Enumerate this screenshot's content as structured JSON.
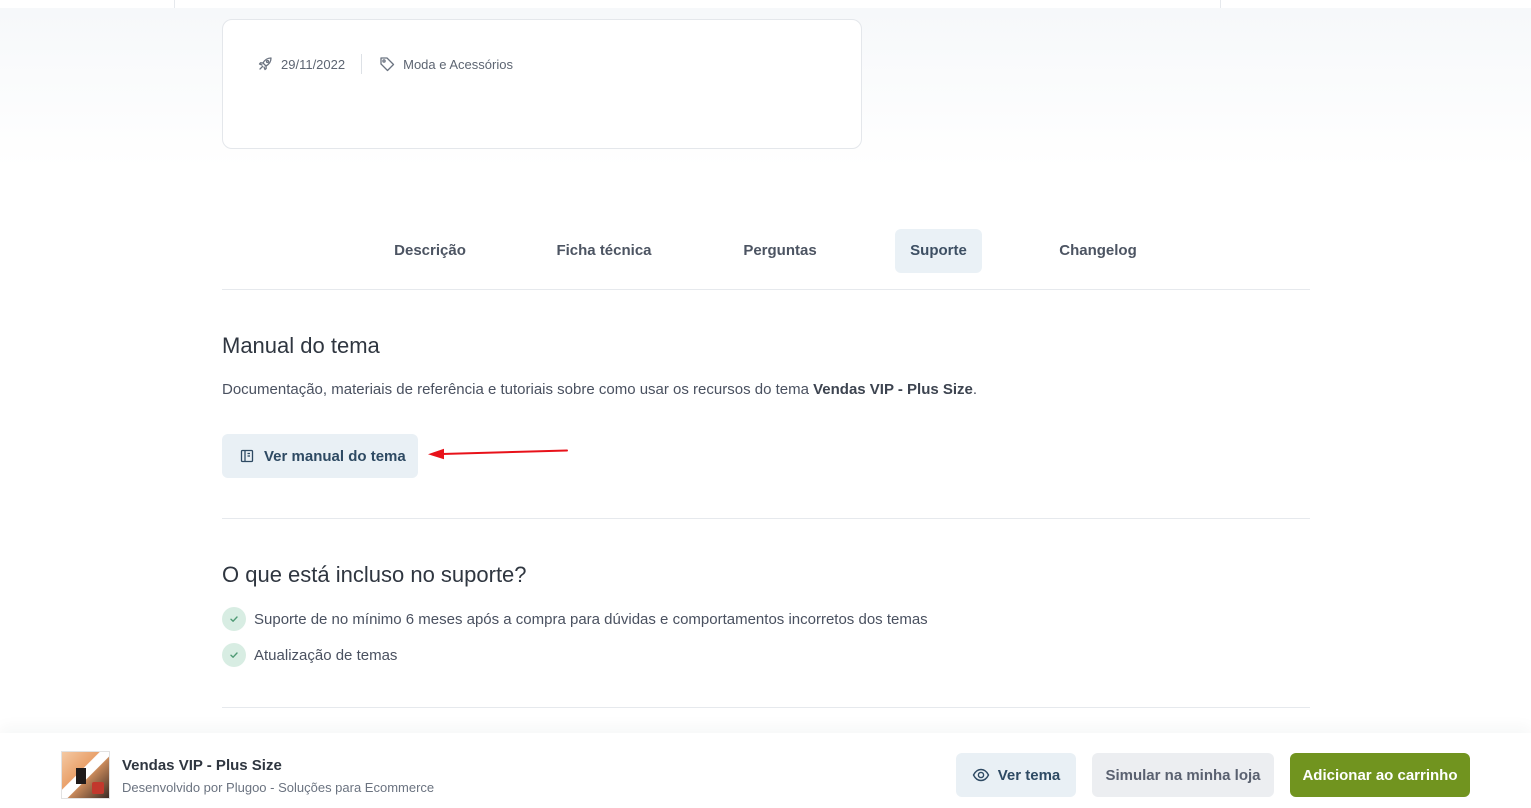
{
  "info_card": {
    "date": "29/11/2022",
    "category": "Moda e Acessórios",
    "icons": [
      "rocket-icon",
      "tag-icon"
    ]
  },
  "tabs": [
    {
      "label": "Descrição",
      "active": false
    },
    {
      "label": "Ficha técnica",
      "active": false
    },
    {
      "label": "Perguntas",
      "active": false
    },
    {
      "label": "Suporte",
      "active": true
    },
    {
      "label": "Changelog",
      "active": false
    }
  ],
  "manual": {
    "title": "Manual do tema",
    "description_prefix": "Documentação, materiais de referência e tutoriais sobre como usar os recursos do tema ",
    "theme_name": "Vendas VIP - Plus Size",
    "description_suffix": ".",
    "button_label": "Ver manual do tema",
    "button_icon": "book-icon"
  },
  "support": {
    "title": "O que está incluso no suporte?",
    "items": [
      "Suporte de no mínimo 6 meses após a compra para dúvidas e comportamentos incorretos dos temas",
      "Atualização de temas"
    ]
  },
  "bottom_bar": {
    "product_name": "Vendas VIP - Plus Size",
    "developer": "Desenvolvido por Plugoo - Soluções para Ecommerce",
    "view_label": "Ver tema",
    "simulate_label": "Simular na minha loja",
    "add_to_cart_label": "Adicionar ao carrinho"
  },
  "colors": {
    "accent_green": "#71941f",
    "light_blue_button": "#e9f0f5",
    "annotation_arrow": "#e8121a",
    "check_bg": "#d8ede3"
  }
}
